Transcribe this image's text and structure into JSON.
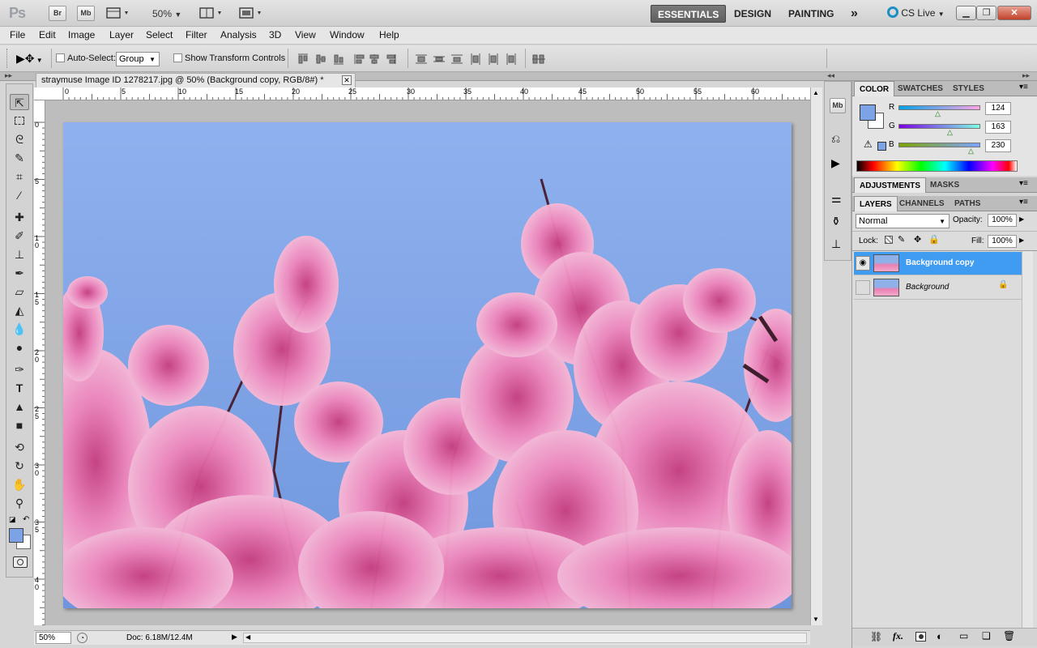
{
  "appbar": {
    "logo": "Ps",
    "bridge_btn": "Br",
    "minibridge_btn": "Mb",
    "zoom_level": "50%",
    "workspaces": [
      "ESSENTIALS",
      "DESIGN",
      "PAINTING"
    ],
    "more_workspaces": "»",
    "cslive": "CS Live",
    "win_min": "▁",
    "win_restore": "❐",
    "win_close": "✕"
  },
  "menubar": {
    "items": [
      "File",
      "Edit",
      "Image",
      "Layer",
      "Select",
      "Filter",
      "Analysis",
      "3D",
      "View",
      "Window",
      "Help"
    ]
  },
  "options": {
    "auto_select_label": "Auto-Select:",
    "auto_select_value": "Group",
    "show_transform_label": "Show Transform Controls"
  },
  "document": {
    "tab_title": "straymuse Image ID 1278217.jpg @ 50% (Background copy, RGB/8#) *",
    "tab_close": "✕",
    "ruler_top_ticks": [
      "0",
      "5",
      "10",
      "15",
      "20",
      "25",
      "30",
      "35",
      "40",
      "45",
      "50",
      "55",
      "60"
    ],
    "ruler_left_ticks": [
      "0",
      "5",
      "1\n0",
      "1\n5",
      "2\n0",
      "2\n5",
      "3\n0",
      "3\n5",
      "4\n0"
    ],
    "status_zoom": "50%",
    "status_doc": "Doc: 6.18M/12.4M"
  },
  "color_panel": {
    "tabs": [
      "COLOR",
      "SWATCHES",
      "STYLES"
    ],
    "r_label": "R",
    "r_value": "124",
    "g_label": "G",
    "g_value": "163",
    "b_label": "B",
    "b_value": "230",
    "fg_color": "#7ca3e6",
    "bg_color": "#ffffff"
  },
  "adjustments_panel": {
    "tabs": [
      "ADJUSTMENTS",
      "MASKS"
    ]
  },
  "layers_panel": {
    "tabs": [
      "LAYERS",
      "CHANNELS",
      "PATHS"
    ],
    "blend_mode": "Normal",
    "opacity_label": "Opacity:",
    "opacity_value": "100%",
    "lock_label": "Lock:",
    "fill_label": "Fill:",
    "fill_value": "100%",
    "layers": [
      {
        "name": "Background copy",
        "visible": true,
        "selected": true,
        "locked": false
      },
      {
        "name": "Background",
        "visible": false,
        "selected": false,
        "locked": true
      }
    ]
  },
  "colors": {
    "selection_blue": "#3f9cf0",
    "sky_top": "#8fb2ef",
    "blossom": "#e77bb0"
  }
}
